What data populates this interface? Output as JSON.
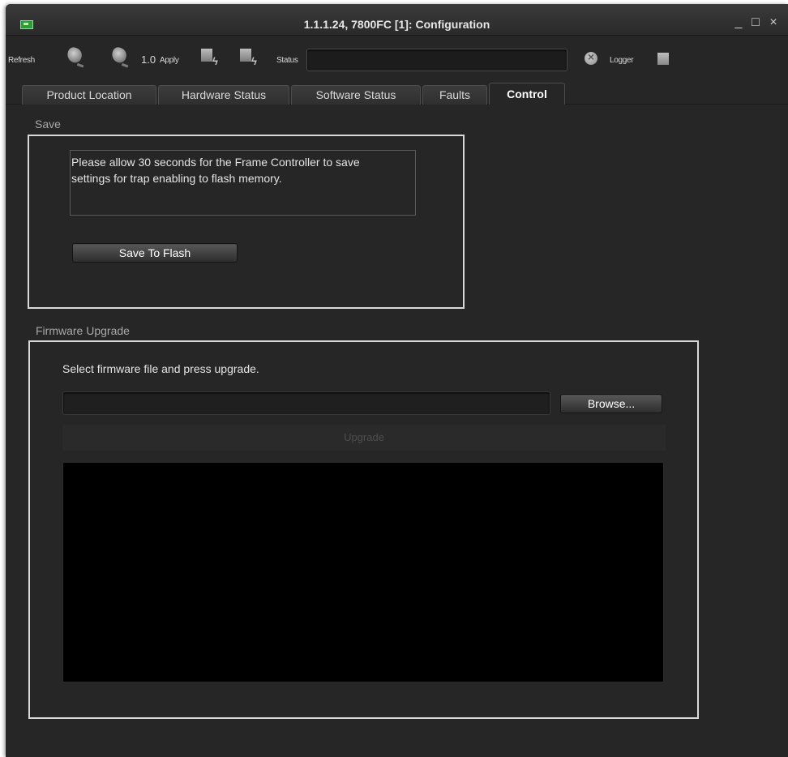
{
  "window": {
    "title": "1.1.1.24, 7800FC  [1]: Configuration",
    "controls": [
      "_",
      "□",
      "×"
    ]
  },
  "toolbar": {
    "refresh_label": "Refresh",
    "version_value": "1.0",
    "apply_label": "Apply",
    "status_label": "Status",
    "status_value": "",
    "logger_label": "Logger",
    "icons": [
      "refresh-gear-icon",
      "refresh-all-gear-icon",
      "apply-bolt-icon",
      "apply-all-bolt-icon",
      "stop-icon",
      "logger-icon"
    ]
  },
  "tabs": [
    {
      "label": "Product Location",
      "active": false
    },
    {
      "label": "Hardware Status",
      "active": false
    },
    {
      "label": "Software Status",
      "active": false
    },
    {
      "label": "Faults",
      "active": false
    },
    {
      "label": "Control",
      "active": true
    }
  ],
  "save": {
    "section_label": "Save",
    "message_line1": "Please allow 30 seconds for the Frame Controller to save",
    "message_line2": "settings for trap enabling to flash memory.",
    "button_label": "Save To Flash"
  },
  "firmware": {
    "section_label": "Firmware Upgrade",
    "instruction": "Select firmware file and press upgrade.",
    "file_path": "",
    "browse_label": "Browse...",
    "upgrade_label": "Upgrade",
    "log_text": ""
  },
  "colors": {
    "window_bg": "#262626",
    "group_border": "#d9d9d9",
    "log_bg": "#000000",
    "app_icon": "#2d9b3a"
  }
}
